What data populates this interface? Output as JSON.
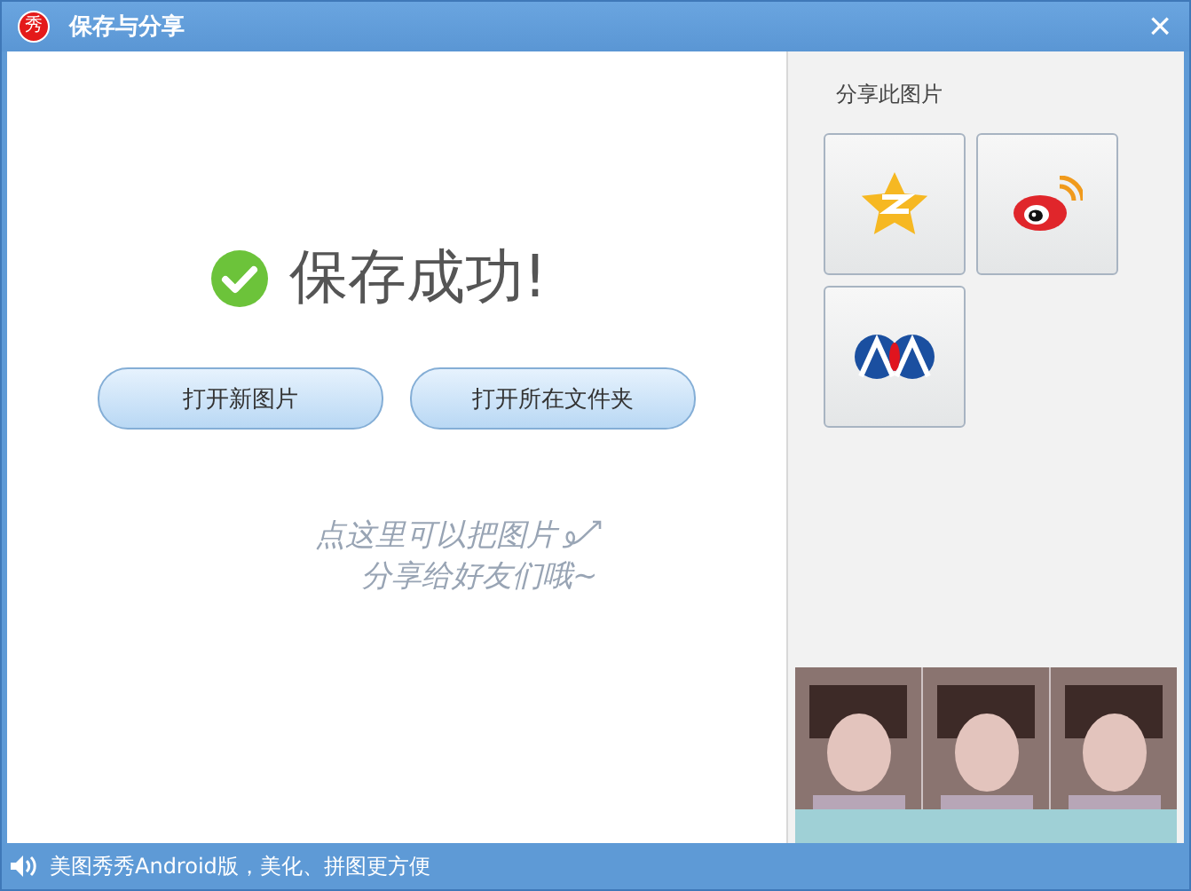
{
  "window": {
    "title": "保存与分享",
    "logo": "秀",
    "close": "×"
  },
  "main": {
    "message": "保存成功!",
    "success": true,
    "buttons": [
      "打开新图片",
      "打开所在文件夹"
    ],
    "hint_lines": [
      "点这里可以把图片",
      "分享给好友们哦~"
    ]
  },
  "share": {
    "title": "分享此图片",
    "targets": [
      {
        "kind": "star"
      },
      {
        "kind": "weibo"
      },
      {
        "kind": "renren"
      }
    ]
  },
  "status_bar": {
    "text": "美图秀秀Android版，美化、拼图更方便"
  }
}
